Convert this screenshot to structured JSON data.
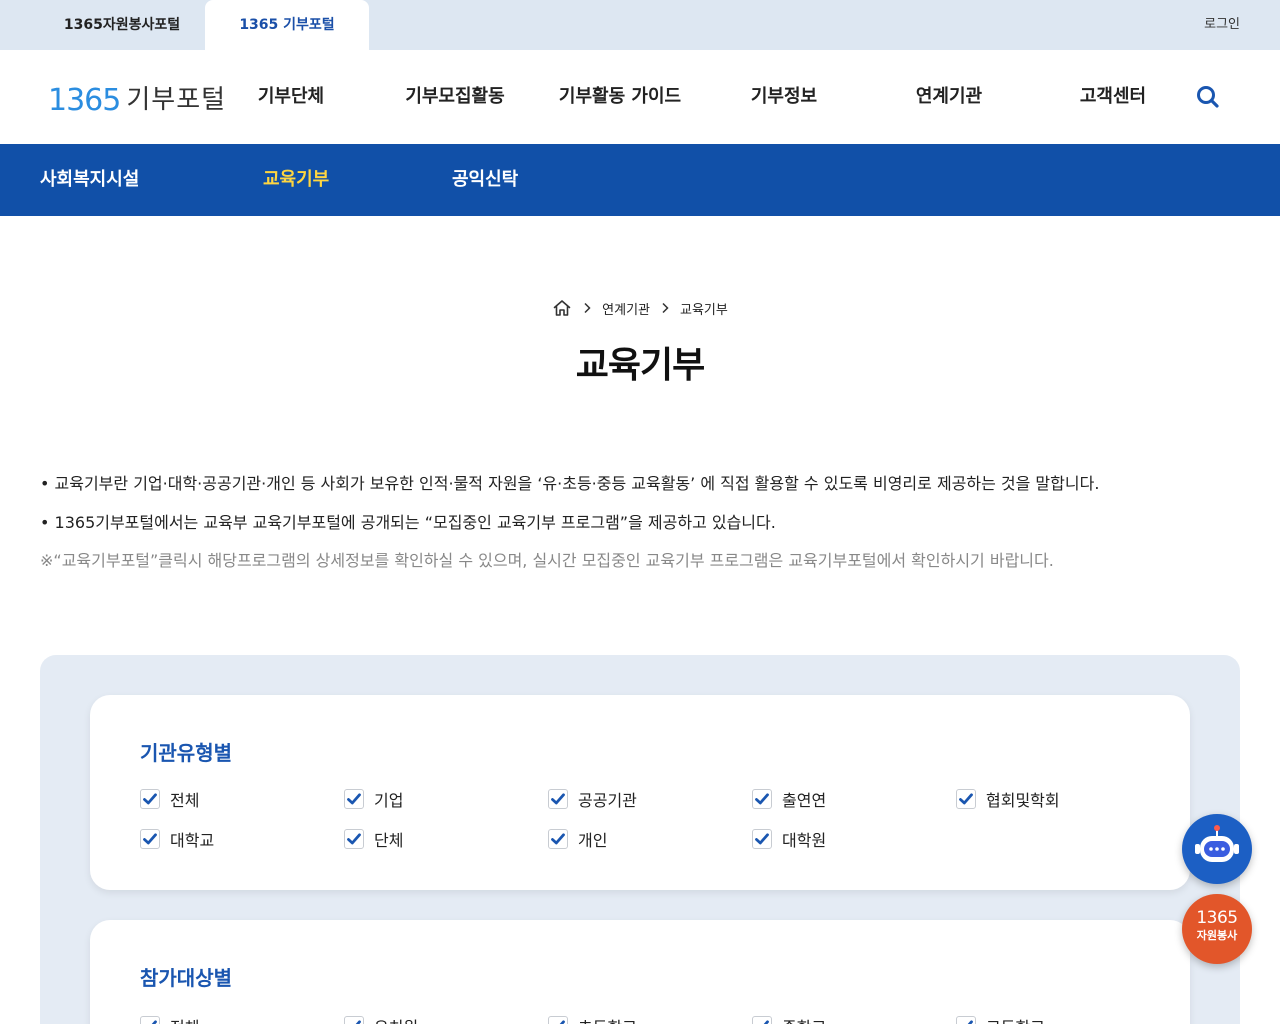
{
  "site_tabs": [
    "1365자원봉사포털",
    "1365 기부포털"
  ],
  "login_label": "로그인",
  "logo": {
    "number": "1365",
    "text": "기부포털"
  },
  "gnb": [
    "기부단체",
    "기부모집활동",
    "기부활동 가이드",
    "기부정보",
    "연계기관",
    "고객센터"
  ],
  "subnav": [
    "사회복지시설",
    "교육기부",
    "공익신탁"
  ],
  "subnav_active": "교육기부",
  "breadcrumb": [
    "연계기관",
    "교육기부"
  ],
  "page_title": "교육기부",
  "description": [
    "• 교육기부란 기업·대학·공공기관·개인 등 사회가 보유한 인적·물적 자원을 ‘유·초등·중등 교육활동’ 에 직접 활용할 수 있도록 비영리로 제공하는 것을 말합니다.",
    "• 1365기부포털에서는 교육부 교육기부포털에 공개되는 “모집중인 교육기부 프로그램”을 제공하고 있습니다."
  ],
  "note": "※“교육기부포털”클릭시 해당프로그램의 상세정보를 확인하실 수 있으며, 실시간 모집중인 교육기부 프로그램은 교육기부포털에서 확인하시기 바랍니다.",
  "filters": {
    "org_type": {
      "title": "기관유형별",
      "options": [
        "전체",
        "기업",
        "공공기관",
        "출연연",
        "협회및학회",
        "대학교",
        "단체",
        "개인",
        "대학원"
      ]
    },
    "target": {
      "title": "참가대상별",
      "options": [
        "전체",
        "유치원",
        "초등학교",
        "중학교",
        "고등학교"
      ]
    }
  },
  "fab": {
    "volunteer_number": "1365",
    "volunteer_label": "자원봉사"
  },
  "colors": {
    "primary": "#1150a8",
    "accent": "#ffd640",
    "check": "#1a56b0",
    "panel": "#e4ebf4",
    "fab_orange": "#e2562a"
  }
}
